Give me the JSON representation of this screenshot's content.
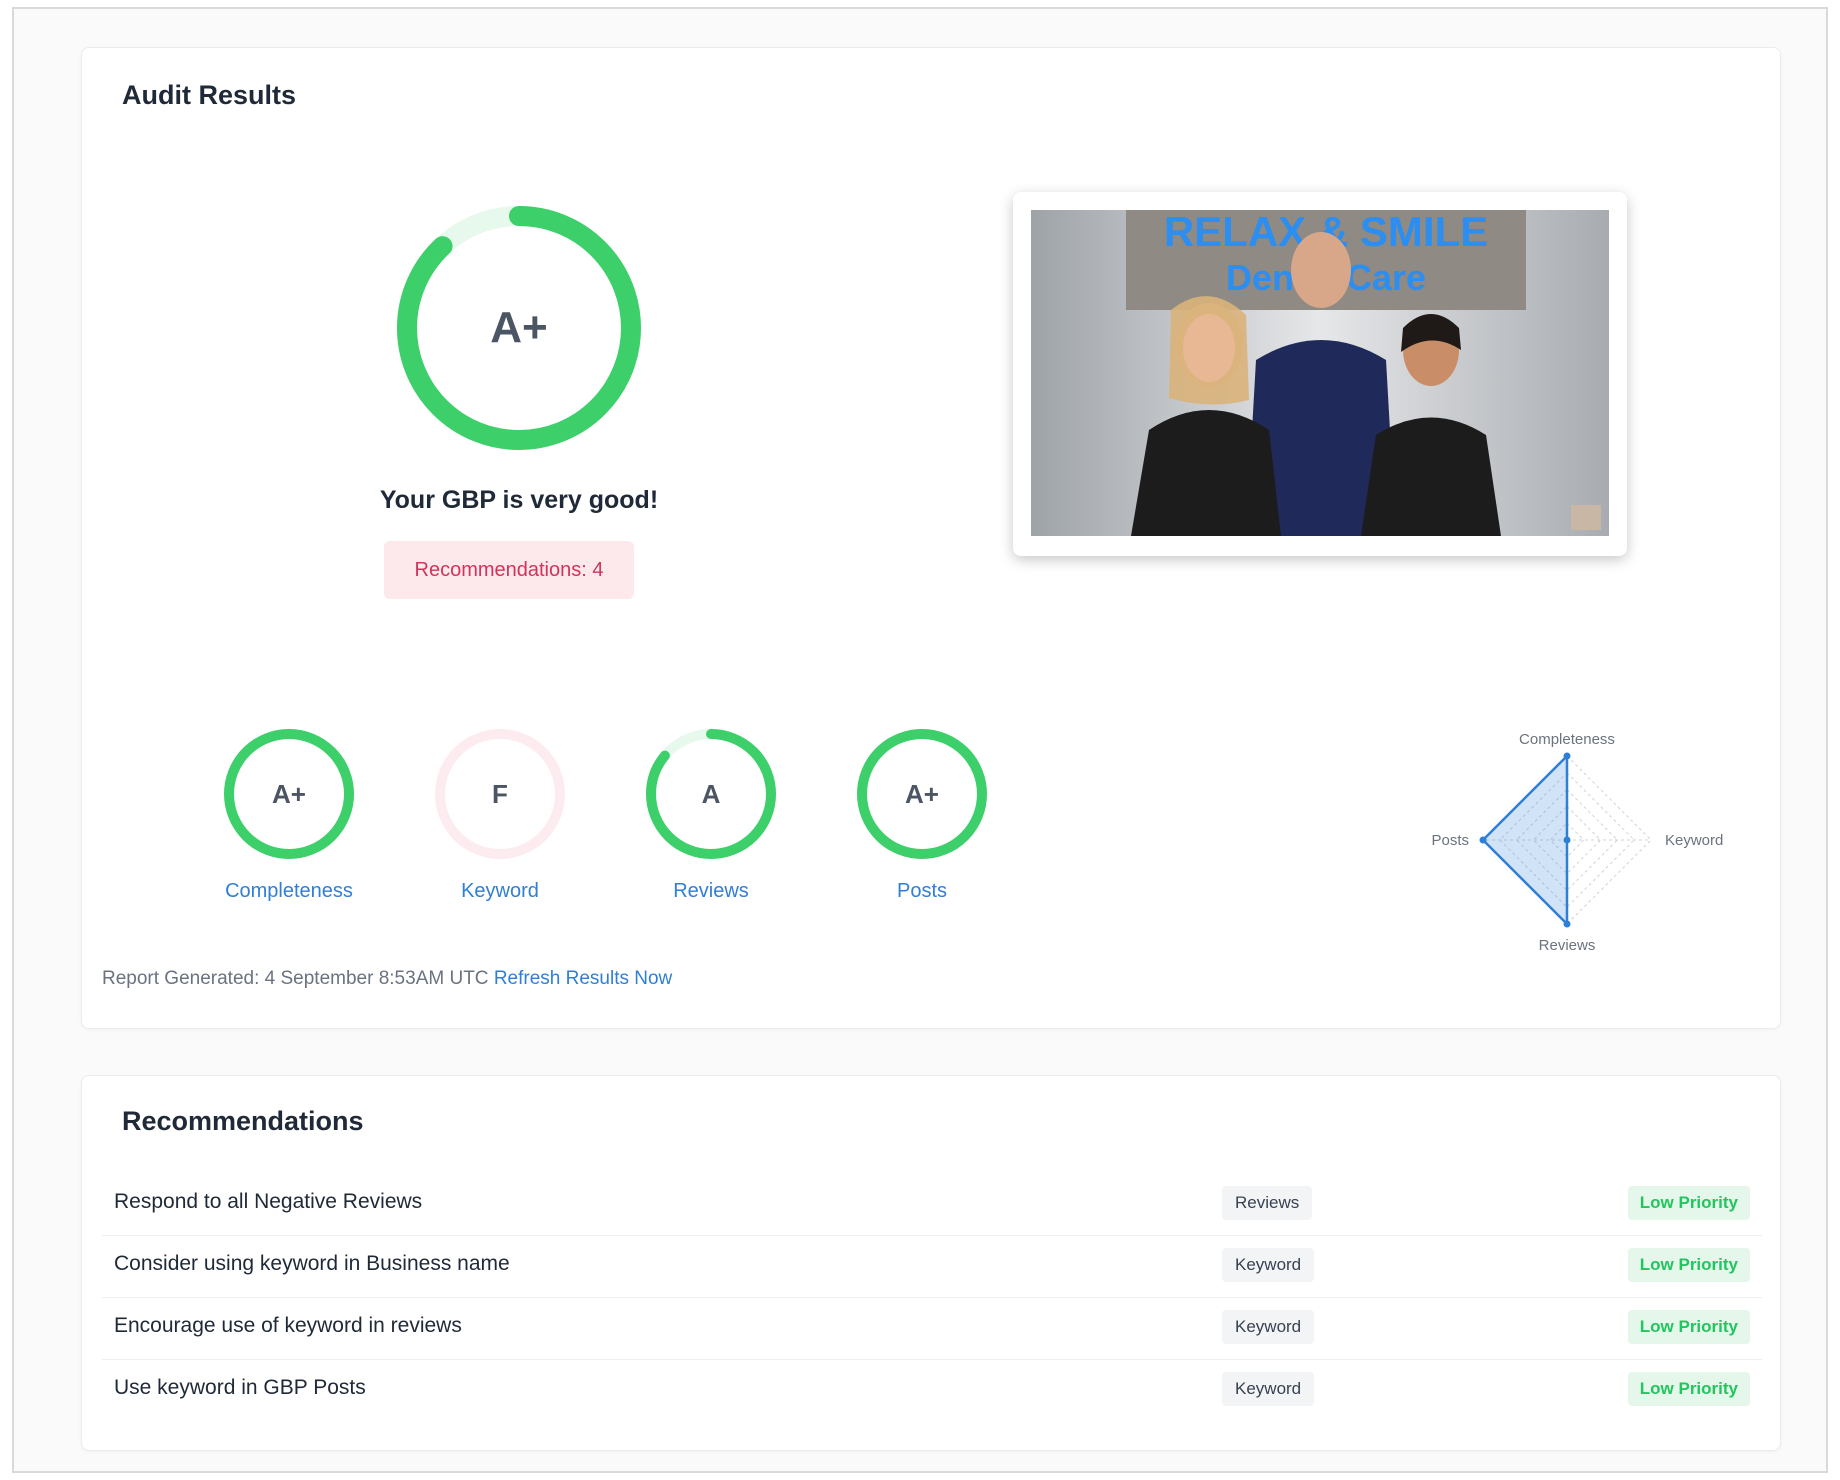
{
  "audit": {
    "title": "Audit Results",
    "overall_grade": "A+",
    "overall_progress": 0.88,
    "verdict": "Your GBP is very good!",
    "recommendations_badge": "Recommendations: 4",
    "photo_sign_line1": "RELAX & SMILE",
    "photo_sign_line2": "Dental Care",
    "colors": {
      "accent_green": "#3ccf6a",
      "track_green": "#e7f8ec",
      "track_pink": "#fdecef",
      "link_blue": "#2f7fd6",
      "badge_pink": "#d0345a"
    },
    "scores": [
      {
        "label": "Completeness",
        "grade": "A+",
        "progress": 1.0,
        "color": "#3ccf6a",
        "track": "#e7f8ec"
      },
      {
        "label": "Keyword",
        "grade": "F",
        "progress": 0.0,
        "color": "#f4a5b3",
        "track": "#fdecef"
      },
      {
        "label": "Reviews",
        "grade": "A",
        "progress": 0.86,
        "color": "#3ccf6a",
        "track": "#e7f8ec"
      },
      {
        "label": "Posts",
        "grade": "A+",
        "progress": 1.0,
        "color": "#3ccf6a",
        "track": "#e7f8ec"
      }
    ],
    "report_generated": "Report Generated: 4 September 8:53AM UTC",
    "refresh_link": "Refresh Results Now"
  },
  "chart_data": {
    "type": "radar",
    "axes": [
      "Completeness",
      "Keyword",
      "Reviews",
      "Posts"
    ],
    "values": [
      100,
      0,
      100,
      100
    ],
    "range": [
      0,
      100
    ],
    "rings": 5,
    "color": "#2f7fd6"
  },
  "recommendations": {
    "title": "Recommendations",
    "items": [
      {
        "text": "Respond to all Negative Reviews",
        "category": "Reviews",
        "priority": "Low Priority"
      },
      {
        "text": "Consider using keyword in Business name",
        "category": "Keyword",
        "priority": "Low Priority"
      },
      {
        "text": "Encourage use of keyword in reviews",
        "category": "Keyword",
        "priority": "Low Priority"
      },
      {
        "text": "Use keyword in GBP Posts",
        "category": "Keyword",
        "priority": "Low Priority"
      }
    ]
  }
}
